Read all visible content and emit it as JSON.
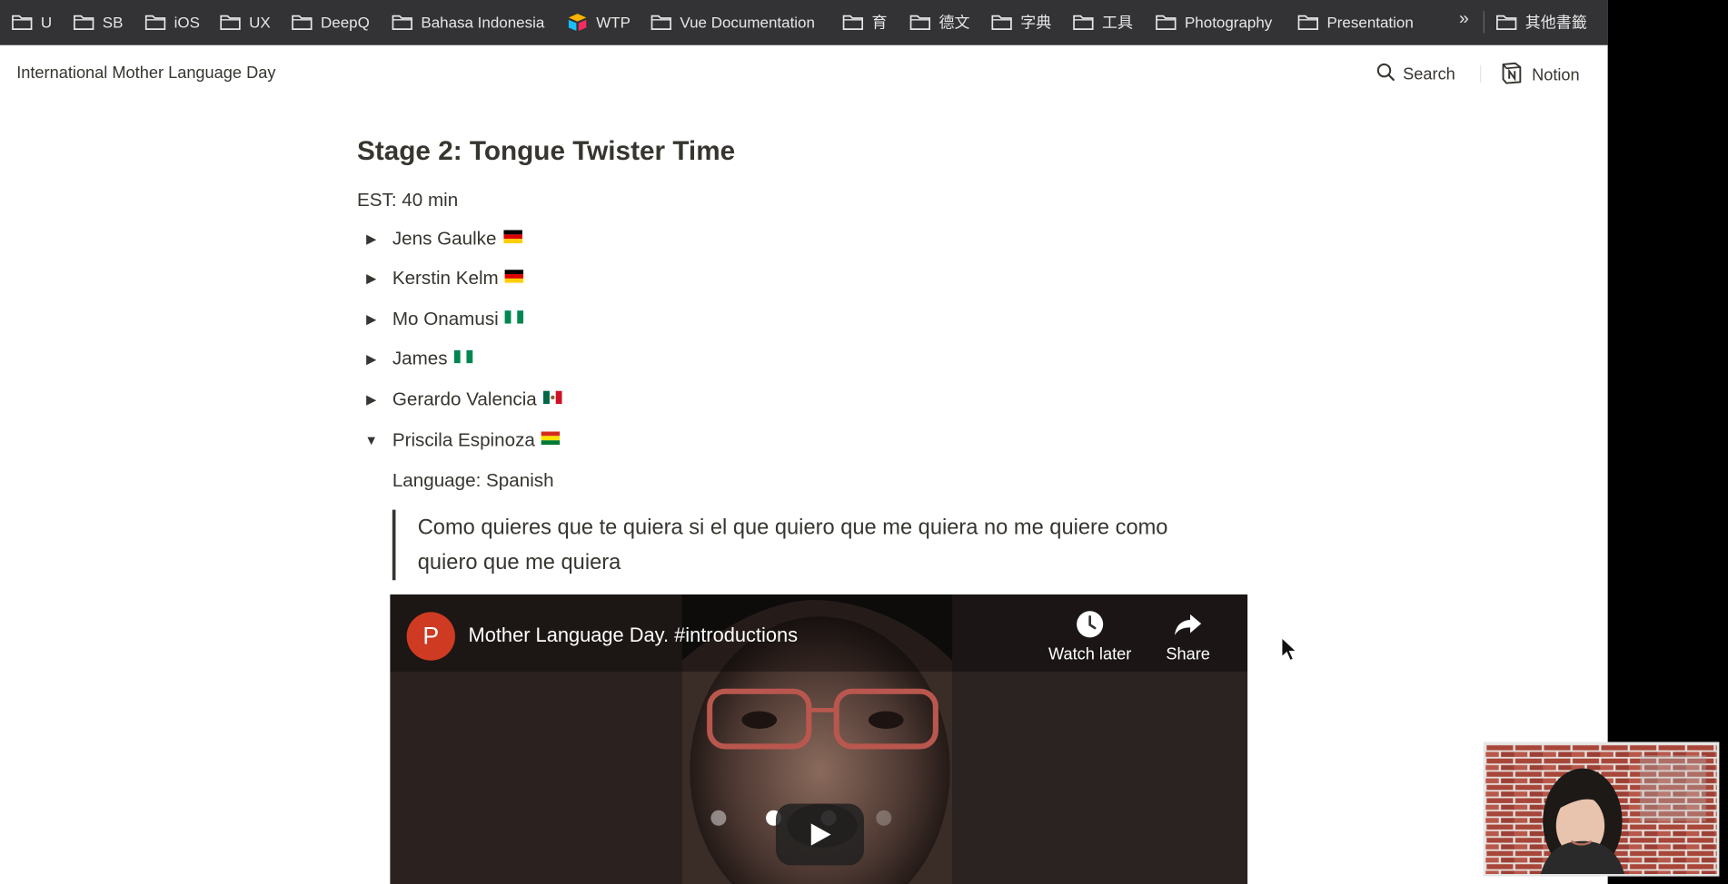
{
  "bookmarks": {
    "items": [
      {
        "label": "U",
        "icon": "folder-icon"
      },
      {
        "label": "SB",
        "icon": "folder-icon"
      },
      {
        "label": "iOS",
        "icon": "folder-icon"
      },
      {
        "label": "UX",
        "icon": "folder-icon"
      },
      {
        "label": "DeepQ",
        "icon": "folder-icon"
      },
      {
        "label": "Bahasa Indonesia",
        "icon": "folder-icon"
      },
      {
        "label": "WTP",
        "icon": "airtable-icon"
      },
      {
        "label": "Vue Documentation",
        "icon": "folder-icon"
      },
      {
        "label": "育",
        "icon": "folder-icon"
      },
      {
        "label": "德文",
        "icon": "folder-icon"
      },
      {
        "label": "字典",
        "icon": "folder-icon"
      },
      {
        "label": "工具",
        "icon": "folder-icon"
      },
      {
        "label": "Photography",
        "icon": "folder-icon"
      },
      {
        "label": "Presentation",
        "icon": "folder-icon"
      }
    ],
    "overflow_label": "»",
    "other_label": "其他書籤"
  },
  "topbar": {
    "page_title": "International Mother Language Day",
    "search_label": "Search",
    "notion_label": "Notion"
  },
  "page": {
    "heading": "Stage 2: Tongue Twister Time",
    "est": "EST: 40 min",
    "toggles": [
      {
        "name": "Jens Gaulke",
        "flag": "germany",
        "expanded": false
      },
      {
        "name": "Kerstin Kelm",
        "flag": "germany",
        "expanded": false
      },
      {
        "name": "Mo Onamusi",
        "flag": "nigeria",
        "expanded": false
      },
      {
        "name": "James",
        "flag": "nigeria",
        "expanded": false
      },
      {
        "name": "Gerardo Valencia",
        "flag": "mexico",
        "expanded": false
      },
      {
        "name": "Priscila Espinoza",
        "flag": "bolivia",
        "expanded": true
      }
    ],
    "language": "Language: Spanish",
    "quote": "Como quieres que te quiera si el que quiero que me quiera no me quiere como quiero que me quiera"
  },
  "video": {
    "channel_initial": "P",
    "title": "Mother Language Day. #introductions",
    "watch_later_label": "Watch later",
    "share_label": "Share"
  },
  "colors": {
    "bookmark_bar": "#333335",
    "text": "#37352f",
    "channel_avatar": "#cf3b22"
  }
}
